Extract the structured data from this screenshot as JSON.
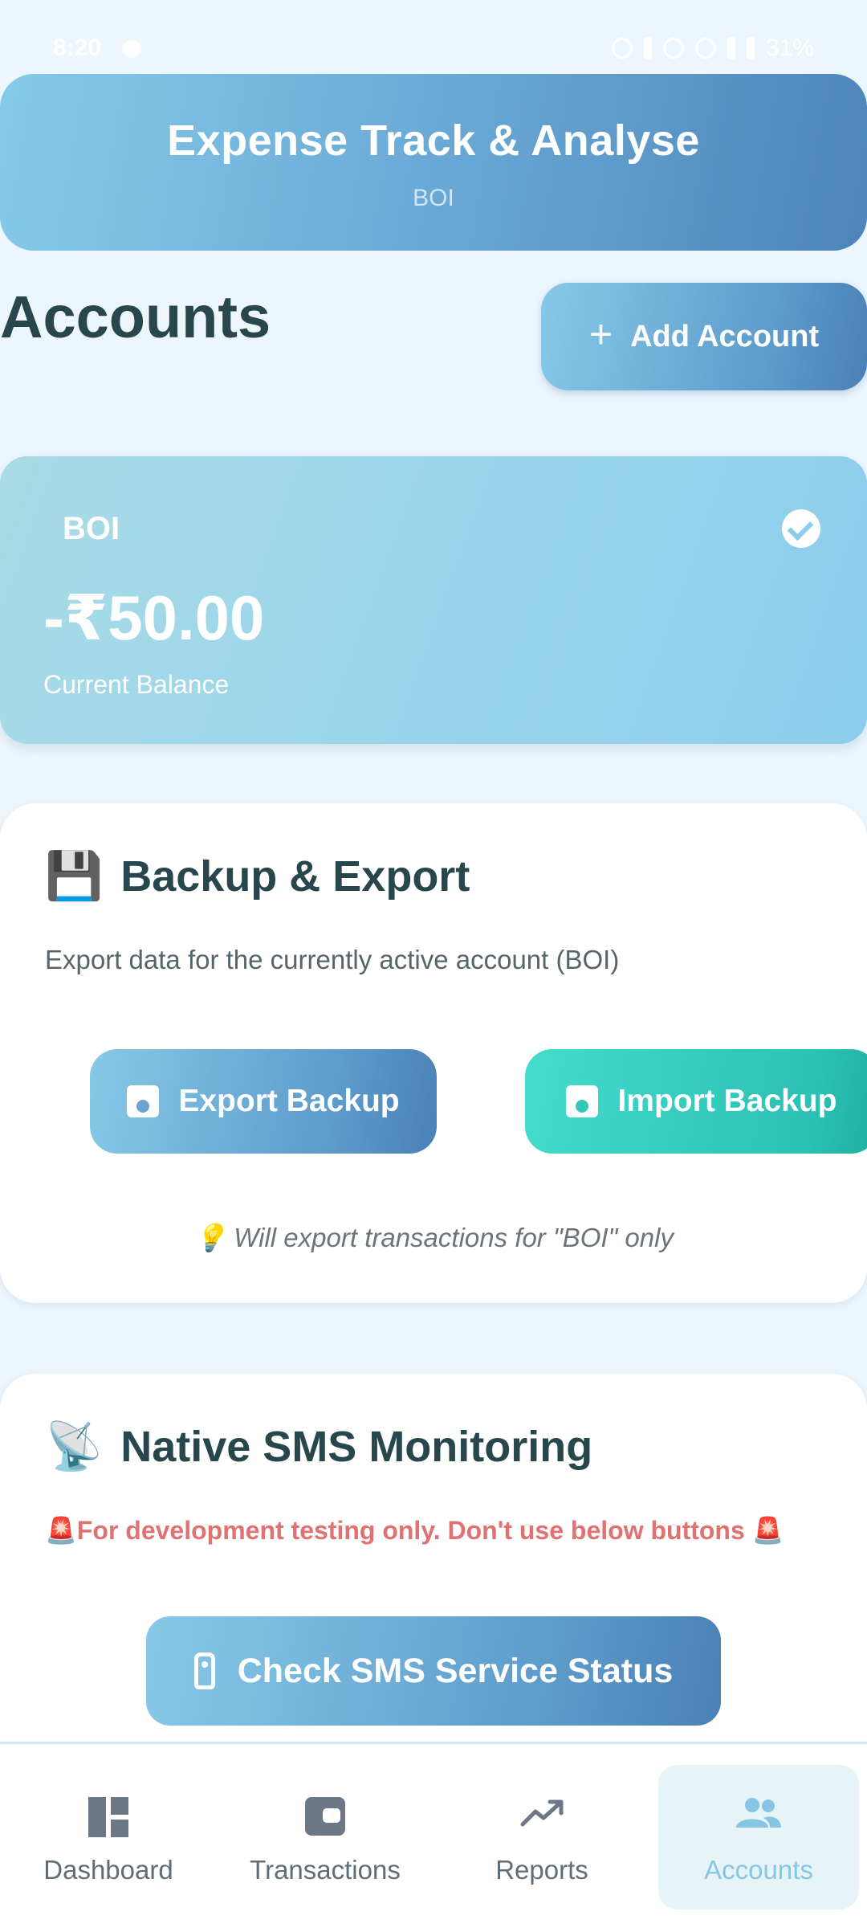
{
  "status_bar": {
    "time": "8:20",
    "battery": "31%"
  },
  "header": {
    "title": "Expense Track & Analyse",
    "active_account": "BOI"
  },
  "page": {
    "title": "Accounts",
    "add_button_label": "Add Account"
  },
  "account_card": {
    "name": "BOI",
    "balance": "-₹50.00",
    "balance_label": "Current Balance"
  },
  "backup": {
    "emoji": "💾",
    "title": "Backup & Export",
    "description": "Export data for the currently active account (BOI)",
    "export_label": "Export Backup",
    "import_label": "Import Backup",
    "hint": "💡 Will export transactions for \"BOI\" only"
  },
  "sms": {
    "emoji": "📡",
    "title": "Native SMS Monitoring",
    "warning": "🚨For development testing only. Don't use below buttons 🚨",
    "check_label": "Check SMS Service Status"
  },
  "nav": {
    "items": [
      {
        "label": "Dashboard",
        "icon": "dashboard-icon"
      },
      {
        "label": "Transactions",
        "icon": "wallet-icon"
      },
      {
        "label": "Reports",
        "icon": "trending-up-icon"
      },
      {
        "label": "Accounts",
        "icon": "people-icon",
        "active": true
      }
    ]
  },
  "colors": {
    "accent": "#86c6e4",
    "primary_gradient_end": "#4a80b5",
    "import_accent": "#2bc1b5",
    "warning": "#e07272"
  }
}
